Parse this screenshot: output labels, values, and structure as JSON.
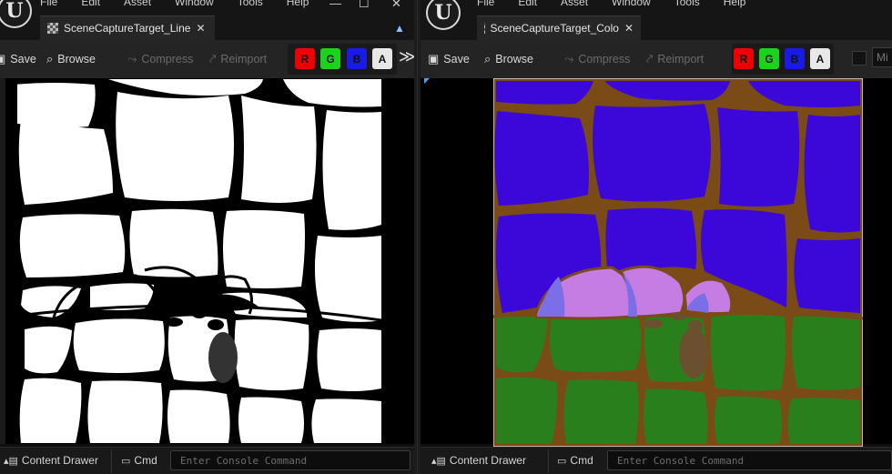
{
  "colors": {
    "panel_bg": "#242424",
    "red_channel": "#ee0000",
    "green_channel": "#1bd31b",
    "blue_channel": "#1a1ae6",
    "alpha_channel": "#e8e8e8",
    "sky_purple": "#3b08d9",
    "ground_green": "#2a7f1d",
    "border_brown": "#7a4b17",
    "dome_pink": "#c57de3"
  },
  "menu": [
    "File",
    "Edit",
    "Asset",
    "Window",
    "Tools",
    "Help"
  ],
  "left_editor": {
    "tab_title": "SceneCaptureTarget_Line",
    "tab_close": "✕",
    "toolbar": {
      "save": "Save",
      "browse": "Browse",
      "compress": "Compress",
      "reimport": "Reimport"
    },
    "channels": [
      "R",
      "G",
      "B",
      "A"
    ],
    "overflow": "≫",
    "bottom": {
      "content_drawer": "Content Drawer",
      "cmd": "Cmd",
      "console_placeholder": "Enter Console Command"
    }
  },
  "right_editor": {
    "tab_title": "SceneCaptureTarget_Colo",
    "tab_close": "✕",
    "toolbar": {
      "save": "Save",
      "browse": "Browse",
      "compress": "Compress",
      "reimport": "Reimport",
      "mip_label": "Mi"
    },
    "channels": [
      "R",
      "G",
      "B",
      "A"
    ],
    "bottom": {
      "content_drawer": "Content Drawer",
      "cmd": "Cmd",
      "console_placeholder": "Enter Console Command"
    }
  },
  "icons": {
    "engine_logo": "unreal-logo",
    "save": "floppy-disk-icon",
    "browse": "folder-search-icon",
    "compress": "compress-icon",
    "reimport": "reimport-icon"
  }
}
